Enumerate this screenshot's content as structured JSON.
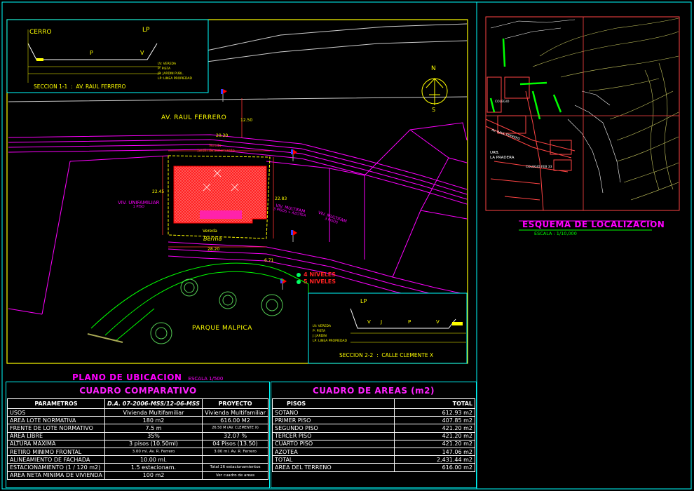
{
  "plan": {
    "title": "PLANO DE UBICACION",
    "scale": "ESCALA 1/500",
    "street_main": "AV. RAUL FERRERO",
    "park": "PARQUE MALPICA",
    "lot_label_top": "Jardín de aislamiento",
    "lot_label_vereda": "Vereda",
    "lot_label_berma": "Berma",
    "viv_unifamiliar": "VIV. UNIFAMILIAR",
    "viv_unifamiliar_sub": "1 PISO",
    "viv_multifam_1": "VIV. MULTIFAM",
    "viv_multifam_1_sub": "3 PISOS + AZOTEA",
    "viv_multifam_2": "VIV. MULTIFAM",
    "viv_multifam_2_sub": "3 PISOS",
    "niveles_4": "4 NIVELES",
    "niveles_5": "5 NIVELES",
    "dim_top": "20.30",
    "dim_right": "22.83",
    "dim_left": "22.45",
    "dim_bottom": "28.20",
    "dim_side": "12.50",
    "dim_671": "6.71",
    "north": "N",
    "south": "S"
  },
  "section_1": {
    "title": "SECCION 1-1",
    "street": "AV. RAUL FERRERO",
    "cerro": "CERRO",
    "lp": "LP",
    "p": "P",
    "v": "V",
    "legend": [
      "LV: VEREDA",
      "P: PISTA",
      "JP: JARDIN PUBL.",
      "LP: LINEA PROPIEDAD"
    ]
  },
  "section_2": {
    "title": "SECCION 2-2",
    "street": "CALLE CLEMENTE X",
    "lp": "LP",
    "v": "V",
    "j": "J",
    "p": "P",
    "legend": [
      "LV: VEREDA",
      "P: PISTA",
      "J: JARDIN",
      "LP: LINEA PROPIEDAD"
    ]
  },
  "location": {
    "title": "ESQUEMA DE LOCALIZACION",
    "scale": "ESCALA : 1/10,000",
    "urb": "URB.",
    "urb_name": "LA PRADERA",
    "av_raul": "AV. RAUL FERRERO",
    "colegio": "COLEGIO FEB 33",
    "colegio2": "COLEGIO"
  },
  "cuadro_comparativo": {
    "title": "CUADRO COMPARATIVO",
    "headers": [
      "PARAMETROS",
      "D.A. 07-2006-MSS/12-06-MSS",
      "PROYECTO"
    ],
    "rows": [
      [
        "USOS",
        "Vivienda Multifamiliar",
        "Vivienda Multifamiliar"
      ],
      [
        "AREA LOTE NORMATIVA",
        "180 m2",
        "616.00 M2"
      ],
      [
        "FRENTE DE LOTE NORMATIVO",
        "7.5 m",
        "26.50 M (AV. CLEMENTE X)"
      ],
      [
        "AREA LIBRE",
        "35%",
        "32.07 %"
      ],
      [
        "ALTURA MAXIMA",
        "3 pisos (10.50ml)",
        "04 Pisos (13.50)"
      ],
      [
        "RETIRO MINIMO FRONTAL",
        "3.00 ml. Av. R. Ferrero",
        "3.00 ml. Av. R. Ferrero"
      ],
      [
        "ALINEAMIENTO DE FACHADA",
        "10.00 ml.",
        ""
      ],
      [
        "ESTACIONAMIENTO (1 / 120 m2)",
        "1.5 estacionam.",
        "Total 26 estacionamientos"
      ],
      [
        "AREA NETA MINIMA DE VIVIENDA",
        "100 m2",
        "Ver cuadro de areas"
      ]
    ]
  },
  "cuadro_areas": {
    "title": "CUADRO DE AREAS (m2)",
    "headers": [
      "PISOS",
      "TOTAL"
    ],
    "rows": [
      [
        "SOTANO",
        "612.93 m2"
      ],
      [
        "PRIMER PISO",
        "407.85 m2"
      ],
      [
        "SEGUNDO PISO",
        "421.20 m2"
      ],
      [
        "TERCER PISO",
        "421.20 m2"
      ],
      [
        "CUARTO PISO",
        "421.20 m2"
      ],
      [
        "AZOTEA",
        "147.06 m2"
      ],
      [
        "TOTAL",
        "2,431.44 m2"
      ],
      [
        "AREA DEL TERRENO",
        "616.00 m2"
      ]
    ]
  },
  "colors": {
    "frame_yellow": "#ffff00",
    "cyan": "#00ffff",
    "magenta": "#ff00ff",
    "red": "#ff0000",
    "green": "#00ff00"
  }
}
